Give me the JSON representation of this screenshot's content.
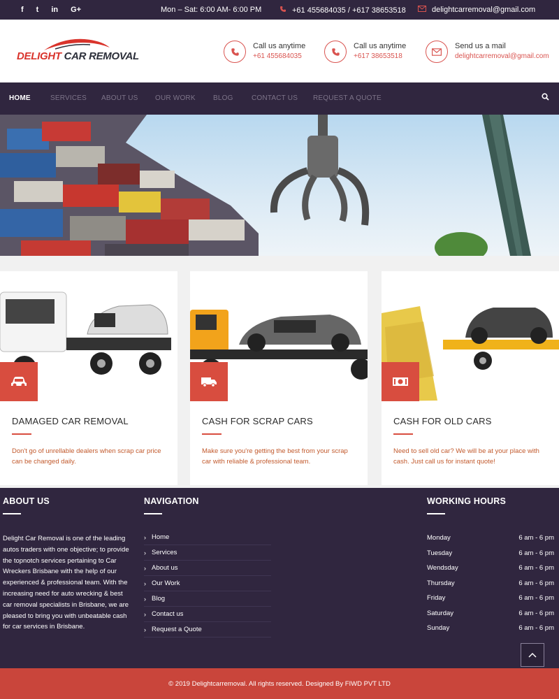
{
  "topbar": {
    "socials": [
      "f",
      "t",
      "in",
      "G+"
    ],
    "hours": "Mon – Sat: 6:00 AM- 6:00 PM",
    "phones": "+61 455684035 / +617 38653518",
    "email": "delightcarremoval@gmail.com"
  },
  "brand": {
    "name_part1": "DELIGHT ",
    "name_part2": "CAR REMOVAL"
  },
  "contacts": [
    {
      "label": "Call us anytime",
      "value": "+61 455684035",
      "icon": "phone-icon"
    },
    {
      "label": "Call us anytime",
      "value": "+617 38653518",
      "icon": "phone-icon"
    },
    {
      "label": "Send us a mail",
      "value": "delightcarremoval@gmail.com",
      "icon": "envelope-icon"
    }
  ],
  "nav": {
    "items": [
      "HOME",
      "SERVICES",
      "ABOUT US",
      "OUR WORK",
      "BLOG",
      "CONTACT US",
      "REQUEST A QUOTE"
    ],
    "active": "HOME"
  },
  "services": [
    {
      "title": "DAMAGED CAR REMOVAL",
      "desc": "Don't go of unrellable dealers when scrap car price can be changed daily.",
      "icon": "car-icon"
    },
    {
      "title": "CASH FOR SCRAP CARS",
      "desc": "Make sure you're getting the best from your scrap car with reliable & professional team.",
      "icon": "truck-icon"
    },
    {
      "title": "CASH FOR OLD CARS",
      "desc": "Need to sell old car? We will be at your place with cash. Just call us for instant quote!",
      "icon": "money-icon"
    }
  ],
  "footer": {
    "about": {
      "heading": "ABOUT US",
      "text": "Delight Car Removal is one of the leading autos traders with one objective; to provide the topnotch services pertaining to Car Wreckers Brisbane with the help of our experienced & professional team. With the increasing need for auto wrecking & best car removal specialists in Brisbane, we are pleased to bring you with unbeatable cash for car services in Brisbane."
    },
    "navigation": {
      "heading": "NAVIGATION",
      "links": [
        "Home",
        "Services",
        "About us",
        "Our Work",
        "Blog",
        "Contact us",
        "Request a Quote"
      ]
    },
    "hours": {
      "heading": "WORKING HOURS",
      "rows": [
        {
          "day": "Monday",
          "time": "6 am - 6 pm"
        },
        {
          "day": "Tuesday",
          "time": "6 am - 6 pm"
        },
        {
          "day": "Wendsday",
          "time": "6 am - 6 pm"
        },
        {
          "day": "Thursday",
          "time": "6 am - 6 pm"
        },
        {
          "day": "Friday",
          "time": "6 am - 6 pm"
        },
        {
          "day": "Saturday",
          "time": "6 am - 6 pm"
        },
        {
          "day": "Sunday",
          "time": "6 am - 6 pm"
        }
      ]
    }
  },
  "copyright": "© 2019 Delightcarremoval. All rights reserved. Designed By FIWD PVT LTD",
  "colors": {
    "dark": "#30263f",
    "accent": "#d84d3f"
  }
}
